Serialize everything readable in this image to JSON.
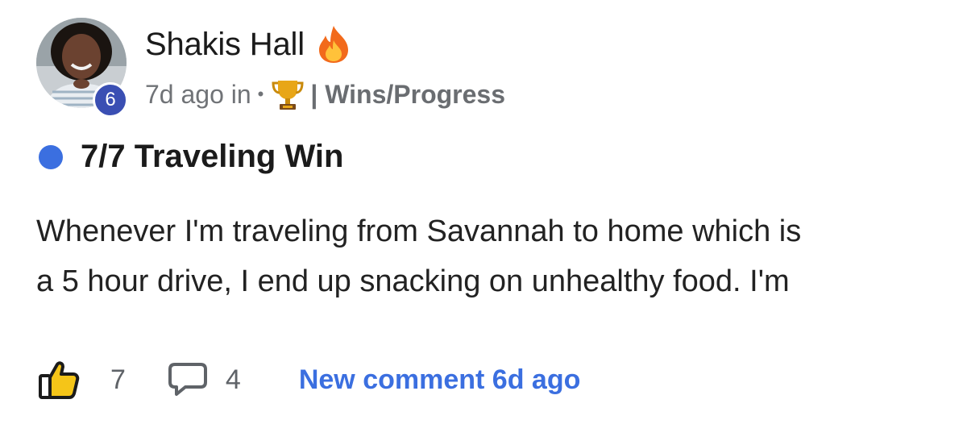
{
  "author": {
    "name": "Shakis Hall",
    "level": "6",
    "status_icon": "fire-icon"
  },
  "meta": {
    "time": "7d ago in",
    "dot": "•",
    "category_icon": "trophy-icon",
    "category": "| Wins/Progress"
  },
  "post": {
    "title": "7/7 Traveling Win",
    "unread_color": "#3b6fe0",
    "body_lines": [
      "Whenever I'm traveling from Savannah to home which is",
      "a 5 hour drive, I end up snacking on unhealthy food. I'm"
    ]
  },
  "footer": {
    "like_icon": "thumbs-up-icon",
    "like_count": "7",
    "comment_icon": "comment-bubble-icon",
    "comment_count": "4",
    "new_comment": "New comment 6d ago",
    "link_color": "#3b6fe0",
    "badge_color": "#3a4fb3"
  }
}
